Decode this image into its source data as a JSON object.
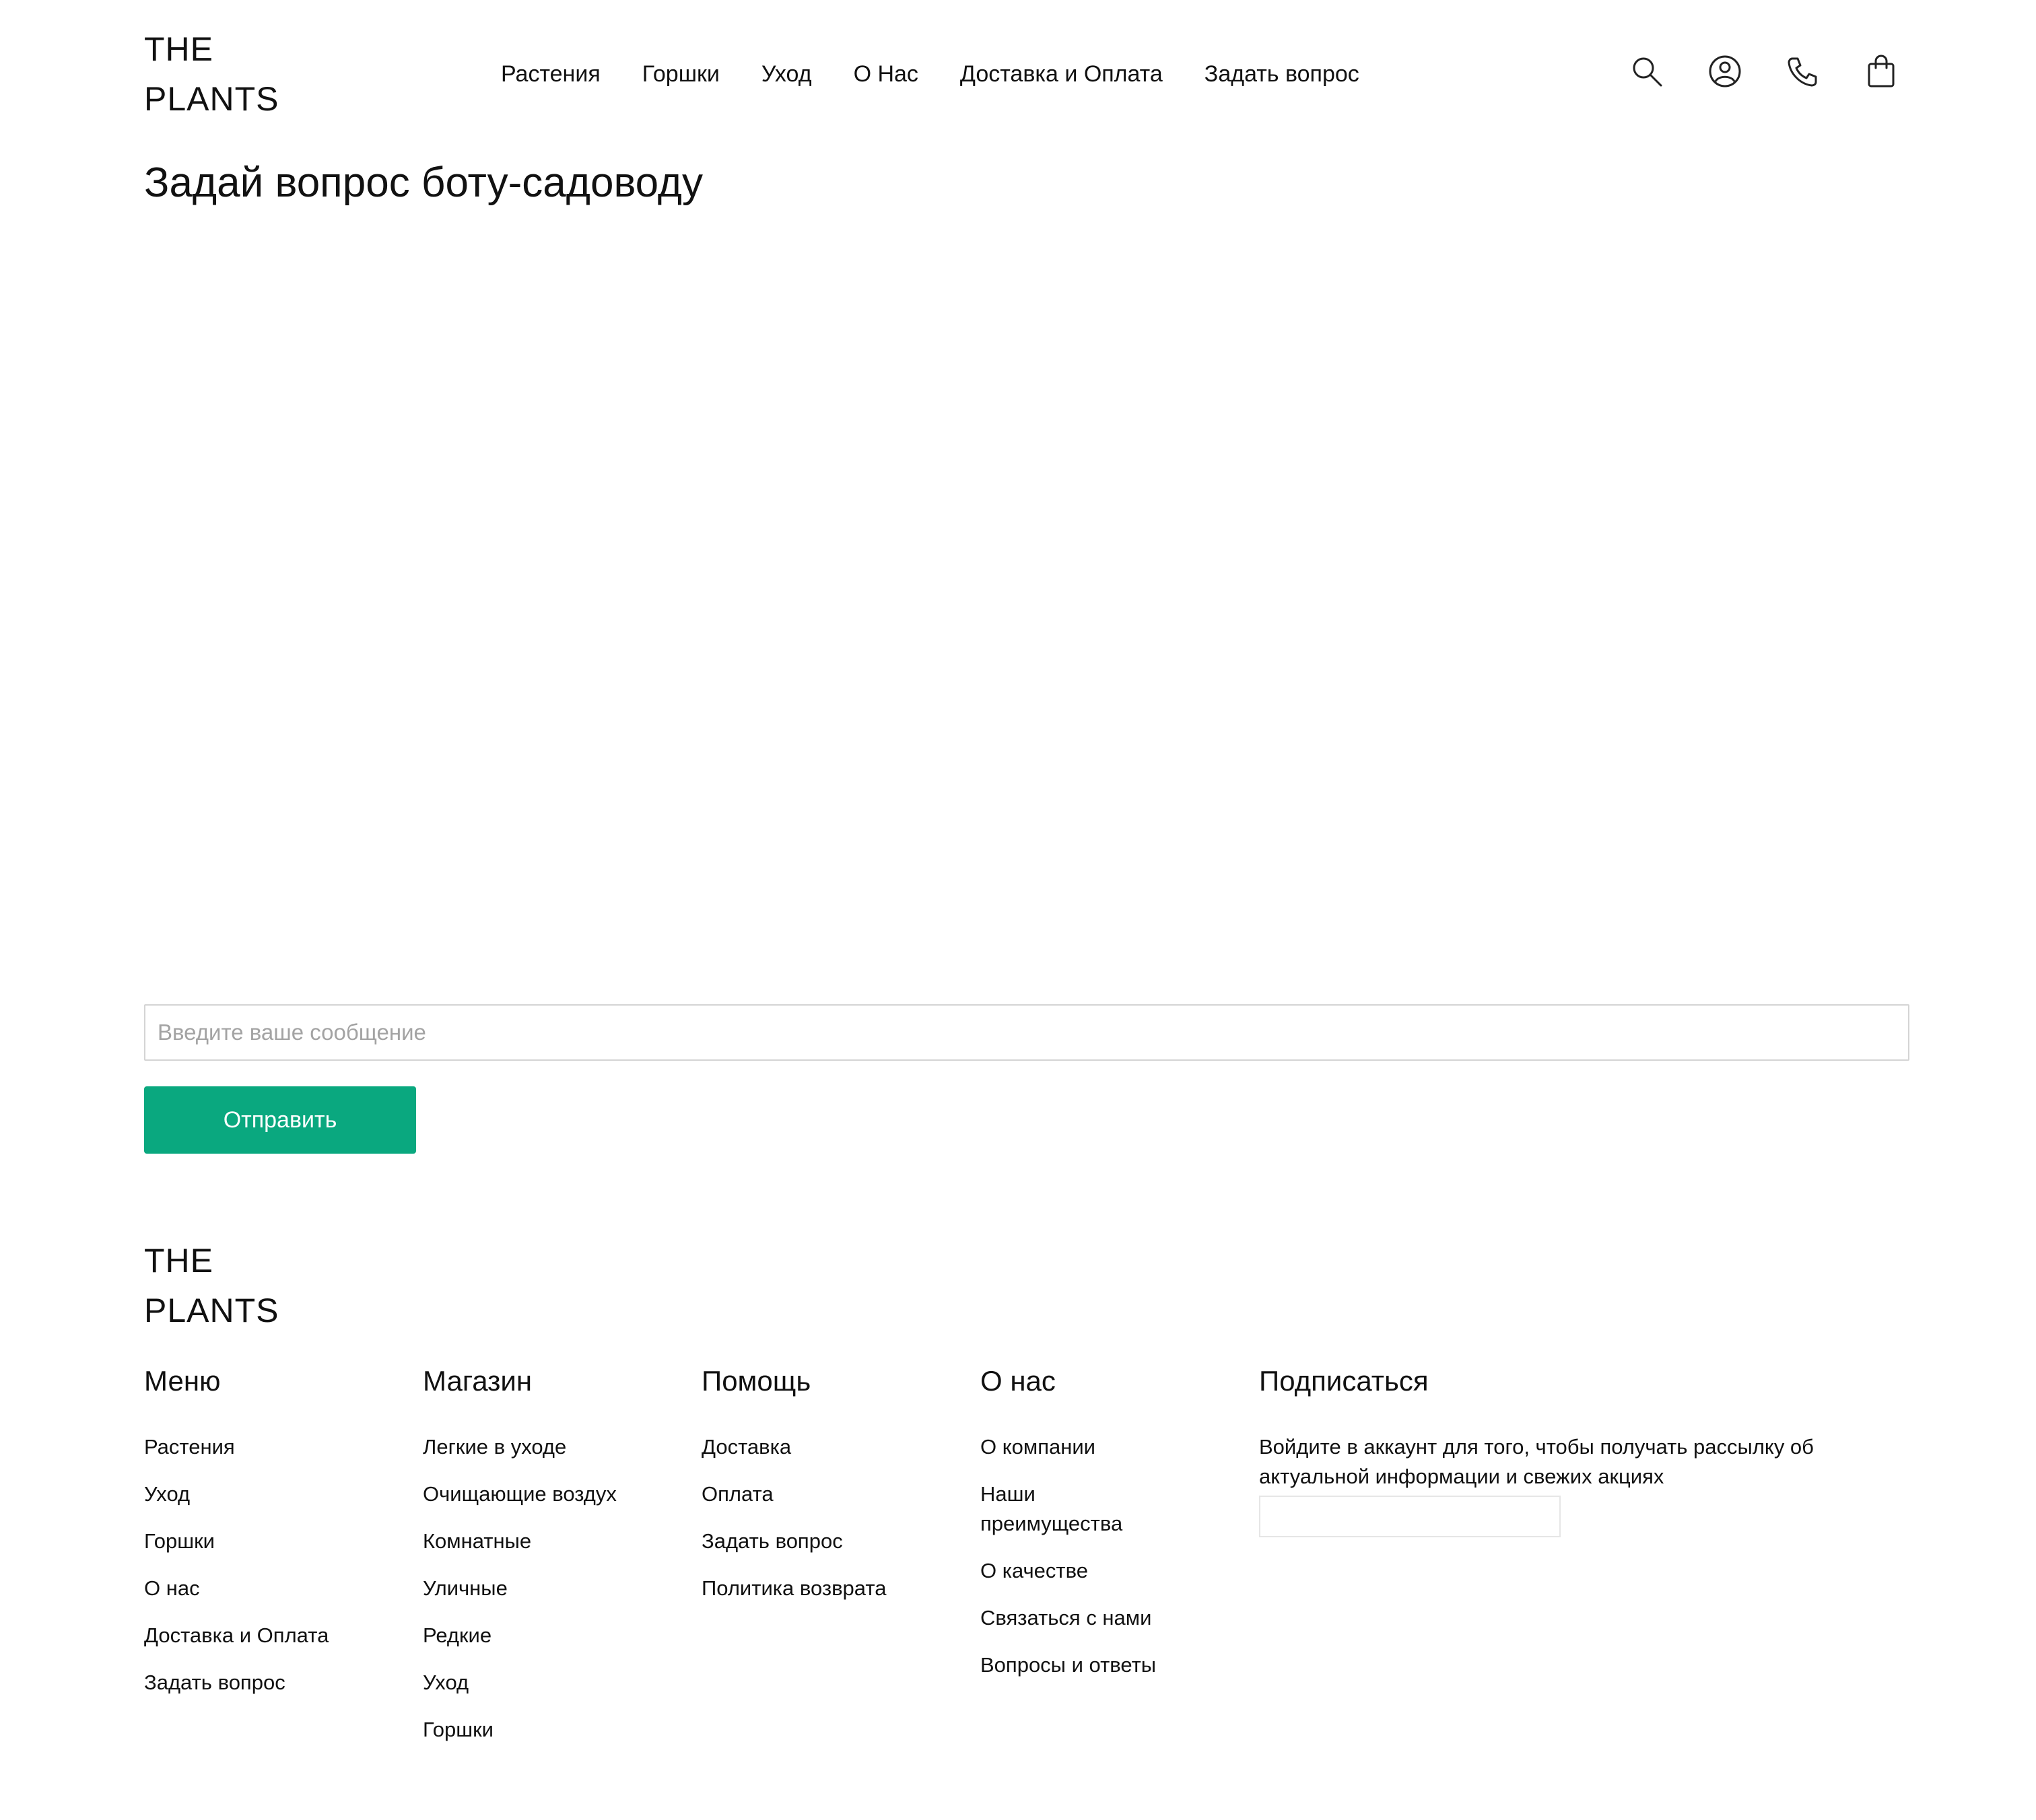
{
  "header": {
    "logo_line1": "THE",
    "logo_line2": "PLANTS",
    "nav": [
      {
        "label": "Растения"
      },
      {
        "label": "Горшки"
      },
      {
        "label": "Уход"
      },
      {
        "label": "О Нас"
      },
      {
        "label": "Доставка и Оплата"
      },
      {
        "label": "Задать вопрос"
      }
    ],
    "icons": [
      "search-icon",
      "user-icon",
      "phone-icon",
      "cart-icon"
    ]
  },
  "main": {
    "title": "Задай вопрос боту-садоводу",
    "input_placeholder": "Введите ваше сообщение",
    "input_value": "",
    "send_label": "Отправить"
  },
  "footer": {
    "logo_line1": "THE",
    "logo_line2": "PLANTS",
    "columns": [
      {
        "heading": "Меню",
        "items": [
          "Растения",
          "Уход",
          "Горшки",
          "О нас",
          "Доставка и Оплата",
          "Задать вопрос"
        ]
      },
      {
        "heading": "Магазин",
        "items": [
          "Легкие в уходе",
          "Очищающие воздух",
          "Комнатные",
          "Уличные",
          "Редкие",
          "Уход",
          "Горшки"
        ]
      },
      {
        "heading": "Помощь",
        "items": [
          "Доставка",
          "Оплата",
          "Задать вопрос",
          "Политика возврата"
        ]
      },
      {
        "heading": "О нас",
        "items": [
          "О компании",
          "Наши преимущества",
          "О качестве",
          "Связаться с нами",
          "Вопросы и ответы"
        ]
      }
    ],
    "subscribe": {
      "heading": "Подписаться",
      "text": "Войдите в аккаунт для того, чтобы получать рассылку об актуальной информации и свежих акциях",
      "input_value": ""
    }
  },
  "colors": {
    "accent": "#0aa87f",
    "text": "#111111",
    "input_border": "#d4d4d4",
    "placeholder": "#a3a3a3"
  }
}
